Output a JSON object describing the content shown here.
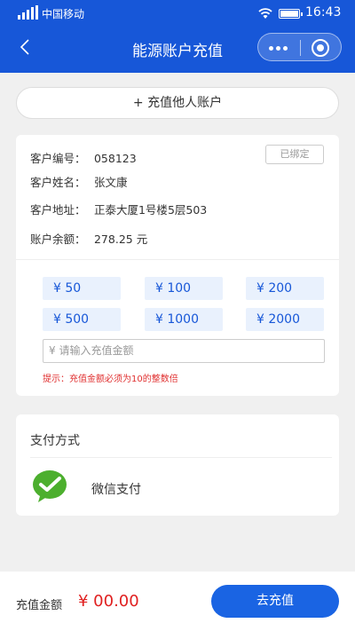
{
  "status_bar": {
    "carrier": "中国移动",
    "time": "16:43"
  },
  "nav": {
    "title": "能源账户充值"
  },
  "add_other_account": "+ 充值他人账户",
  "account": {
    "bound_button": "已绑定",
    "rows": [
      {
        "label": "客户编号：",
        "value": "058123"
      },
      {
        "label": "客户姓名：",
        "value": "张文康"
      },
      {
        "label": "客户地址：",
        "value": "正泰大厦1号楼5层503"
      },
      {
        "label": "账户余额：",
        "value": "278.25 元"
      }
    ]
  },
  "amount_options": [
    "¥ 50",
    "¥ 100",
    "¥ 200",
    "¥ 500",
    "¥ 1000",
    "¥ 2000"
  ],
  "amount_input": {
    "placeholder": "¥ 请输入充值金额"
  },
  "hint": "提示：充值金额必须为10的整数倍",
  "payment": {
    "title": "支付方式",
    "method": "微信支付",
    "icon": "wechat-pay-icon",
    "icon_color": "#4caf2e"
  },
  "footer": {
    "label": "充值金额",
    "value": "¥ 00.00",
    "button": "去充值"
  },
  "colors": {
    "header": "#1757d8",
    "accent": "#1a64e3",
    "price": "#e02020"
  }
}
